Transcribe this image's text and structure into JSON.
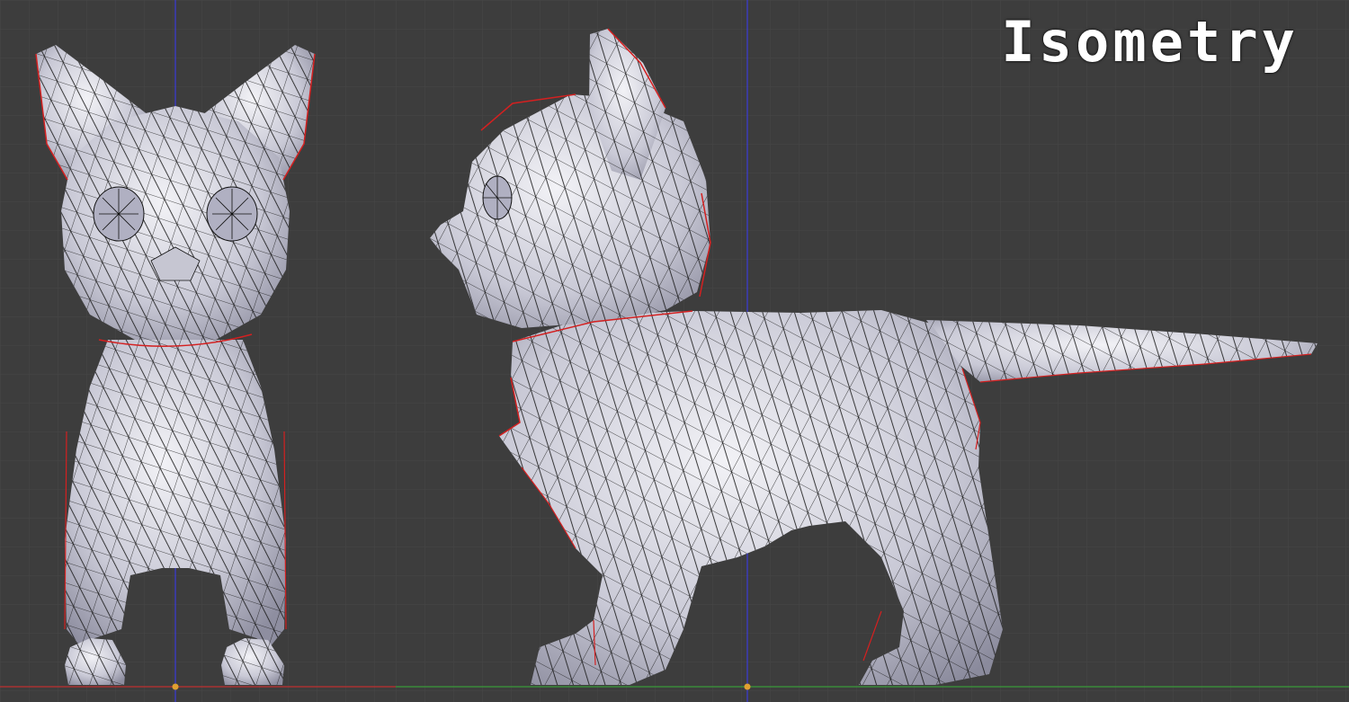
{
  "overlay": {
    "title": "Isometry"
  },
  "colors": {
    "background": "#3d3d3d",
    "grid": "#474747",
    "mesh_fill": "#d9d9e4",
    "mesh_edge": "#111111",
    "seam": "#d42020",
    "axis_z": "#3b3bd8",
    "axis_x": "#c03030",
    "axis_y": "#3a9a3a",
    "origin": "#e0a030"
  },
  "viewports": [
    {
      "name": "front-view"
    },
    {
      "name": "side-view"
    }
  ]
}
